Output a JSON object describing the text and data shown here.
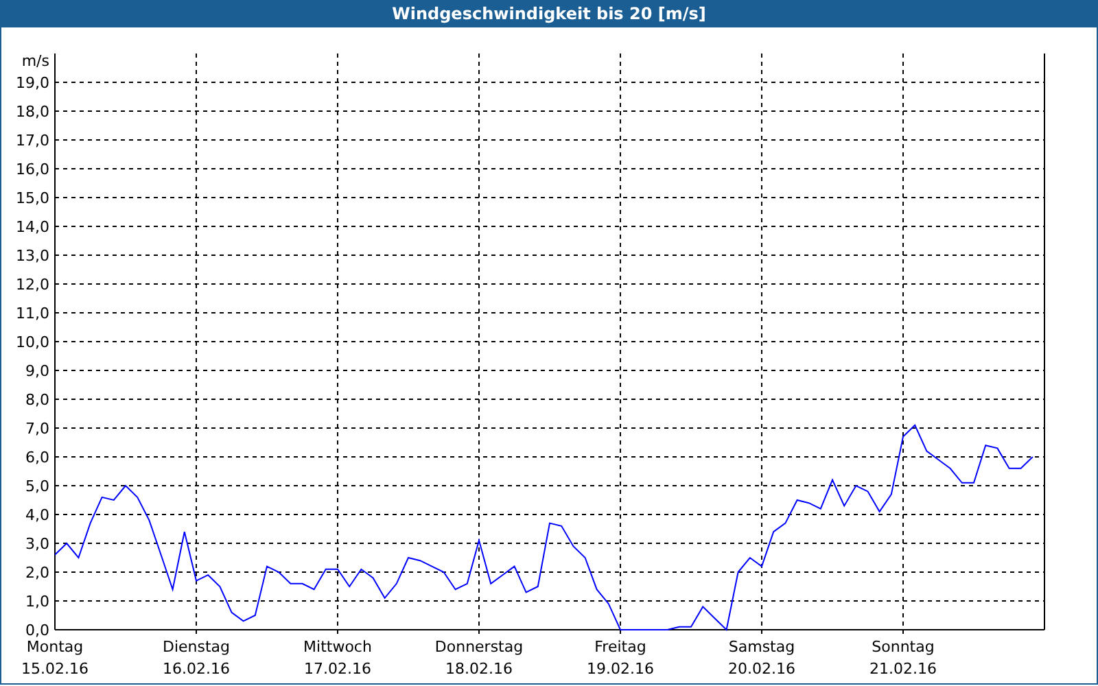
{
  "window": {
    "title": "Windgeschwindigkeit bis 20 [m/s]"
  },
  "chart_data": {
    "type": "line",
    "grid": true,
    "ylabel": "m/s",
    "ylim": [
      0,
      20
    ],
    "yticks": [
      {
        "value": 0,
        "label": "0,0"
      },
      {
        "value": 1,
        "label": "1,0"
      },
      {
        "value": 2,
        "label": "2,0"
      },
      {
        "value": 3,
        "label": "3,0"
      },
      {
        "value": 4,
        "label": "4,0"
      },
      {
        "value": 5,
        "label": "5,0"
      },
      {
        "value": 6,
        "label": "6,0"
      },
      {
        "value": 7,
        "label": "7,0"
      },
      {
        "value": 8,
        "label": "8,0"
      },
      {
        "value": 9,
        "label": "9,0"
      },
      {
        "value": 10,
        "label": "10,0"
      },
      {
        "value": 11,
        "label": "11,0"
      },
      {
        "value": 12,
        "label": "12,0"
      },
      {
        "value": 13,
        "label": "13,0"
      },
      {
        "value": 14,
        "label": "14,0"
      },
      {
        "value": 15,
        "label": "15,0"
      },
      {
        "value": 16,
        "label": "16,0"
      },
      {
        "value": 17,
        "label": "17,0"
      },
      {
        "value": 18,
        "label": "18,0"
      },
      {
        "value": 19,
        "label": "19,0"
      }
    ],
    "categories": [
      "Montag\n15.02.16",
      null,
      null,
      null,
      null,
      null,
      null,
      null,
      null,
      null,
      null,
      null,
      "Dienstag\n16.02.16",
      null,
      null,
      null,
      null,
      null,
      null,
      null,
      null,
      null,
      null,
      null,
      "Mittwoch\n17.02.16",
      null,
      null,
      null,
      null,
      null,
      null,
      null,
      null,
      null,
      null,
      null,
      "Donnerstag\n18.02.16",
      null,
      null,
      null,
      null,
      null,
      null,
      null,
      null,
      null,
      null,
      null,
      "Freitag\n19.02.16",
      null,
      null,
      null,
      null,
      null,
      null,
      null,
      null,
      null,
      null,
      null,
      "Samstag\n20.02.16",
      null,
      null,
      null,
      null,
      null,
      null,
      null,
      null,
      null,
      null,
      null,
      "Sonntag\n21.02.16",
      null,
      null,
      null,
      null,
      null,
      null,
      null,
      null,
      null,
      null,
      null
    ],
    "series": [
      {
        "color": "#0000ff",
        "values": [
          2.6,
          3.0,
          2.5,
          3.7,
          4.6,
          4.5,
          5.0,
          4.6,
          3.8,
          2.6,
          1.4,
          3.4,
          1.7,
          1.9,
          1.5,
          0.6,
          0.3,
          0.5,
          2.2,
          2.0,
          1.6,
          1.6,
          1.4,
          2.1,
          2.1,
          1.5,
          2.1,
          1.8,
          1.1,
          1.6,
          2.5,
          2.4,
          2.2,
          2.0,
          1.4,
          1.6,
          3.1,
          1.6,
          1.9,
          2.2,
          1.3,
          1.5,
          3.7,
          3.6,
          2.9,
          2.5,
          1.4,
          0.9,
          0.0,
          0.0,
          0.0,
          0.0,
          0.0,
          0.1,
          0.1,
          0.8,
          0.4,
          0.0,
          2.0,
          2.5,
          2.2,
          3.4,
          3.7,
          4.5,
          4.4,
          4.2,
          5.2,
          4.3,
          5.0,
          4.8,
          4.1,
          4.7,
          6.7,
          7.1,
          6.2,
          5.9,
          5.6,
          5.1,
          5.1,
          6.4,
          6.3,
          5.6,
          5.6,
          6.0
        ]
      }
    ]
  }
}
